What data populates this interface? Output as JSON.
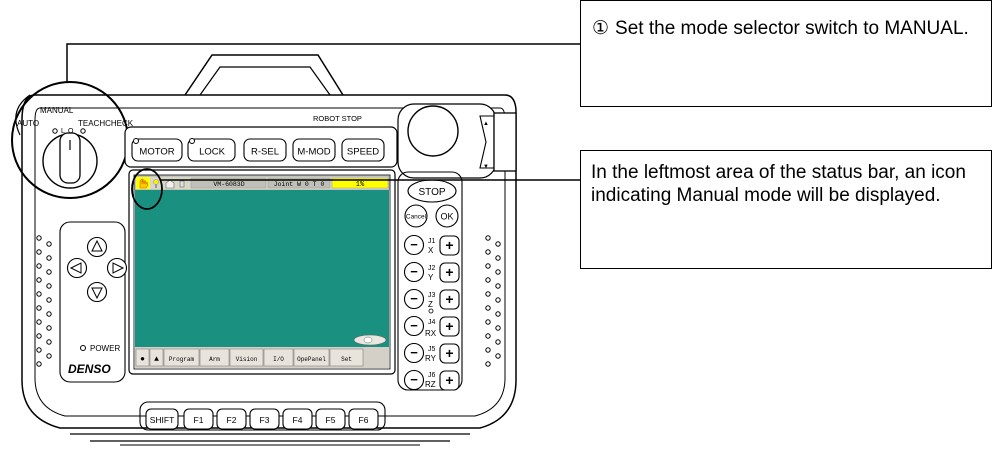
{
  "pendant": {
    "mode_selector": {
      "manual": "MANUAL",
      "auto": "AUTO",
      "teachcheck": "TEACHCHECK",
      "pos_l": "L",
      "pos_o": "O"
    },
    "robot_stop": "ROBOT STOP",
    "top_buttons": [
      "MOTOR",
      "LOCK",
      "R-SEL",
      "M-MOD",
      "SPEED"
    ],
    "power": "POWER",
    "brand": "DENSO",
    "function_keys": [
      "SHIFT",
      "F1",
      "F2",
      "F3",
      "F4",
      "F5",
      "F6"
    ],
    "stop": "STOP",
    "cancel": "Cancel",
    "ok": "OK",
    "jog_labels": [
      [
        "J1",
        "X"
      ],
      [
        "J2",
        "Y"
      ],
      [
        "J3",
        "Z"
      ],
      [
        "J4",
        "RX"
      ],
      [
        "J5",
        "RY"
      ],
      [
        "J6",
        "RZ"
      ]
    ],
    "plus": "+",
    "minus": "−",
    "enable_marks": [
      "▲",
      "▼"
    ]
  },
  "screen": {
    "status": {
      "robot": "VM-6083D",
      "joint": "Joint  W 0 T 0",
      "speed": "1%"
    },
    "tabs": [
      "●",
      "▲",
      "Program",
      "Arm",
      "Vision",
      "I/O",
      "OpePanel",
      "Set"
    ],
    "colors": {
      "screen": "#1a9080",
      "status_bar": "#d8d8c8",
      "speed_box": "#ffff00",
      "tab_bar": "#d4d0c8"
    }
  },
  "callouts": {
    "step1": {
      "num": "①",
      "text": "Set the mode selector switch to MANUAL."
    },
    "step2": {
      "text": "In the leftmost area of the status bar, an icon indicating Manual mode will be displayed."
    }
  }
}
